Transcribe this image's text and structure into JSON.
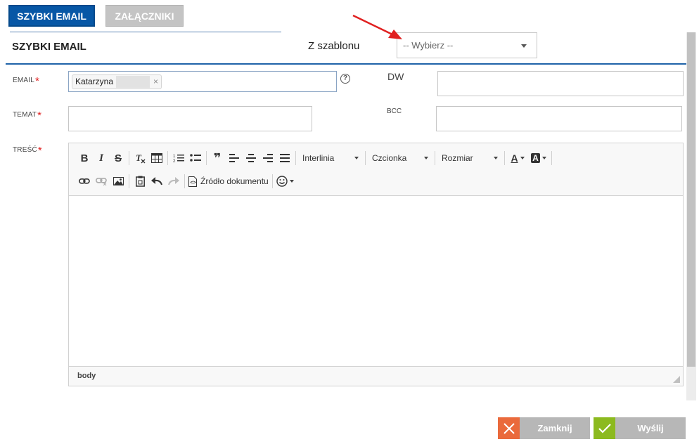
{
  "tabs": [
    {
      "label": "SZYBKI EMAIL",
      "active": true
    },
    {
      "label": "ZAŁĄCZNIKI",
      "active": false
    }
  ],
  "header": {
    "title": "SZYBKI EMAIL",
    "template_label": "Z szablonu",
    "template_select": {
      "selected": "-- Wybierz --"
    }
  },
  "form": {
    "email_label": "EMAIL",
    "email_chip": "Katarzyna",
    "email_chip_remove": "×",
    "help_icon": "?",
    "dw_label": "DW",
    "temat_label": "TEMAT",
    "bcc_label": "BCC",
    "tresc_label": "TREŚĆ",
    "required_marker": "*"
  },
  "toolbar": {
    "bold": "B",
    "italic": "I",
    "strike": "S",
    "quote": "❞",
    "line_height": "Interlinia",
    "font": "Czcionka",
    "size": "Rozmiar",
    "text_color": "A",
    "bg_color": "A",
    "source": "Źródło dokumentu"
  },
  "editor": {
    "status_path": "body"
  },
  "buttons": {
    "close": "Zamknij",
    "send": "Wyślij"
  },
  "colors": {
    "primary": "#0757a6",
    "accent_red": "#e02020",
    "close_icon_bg": "#ea6a3c",
    "send_icon_bg": "#8cba1f",
    "button_grey": "#b7b7b7"
  }
}
